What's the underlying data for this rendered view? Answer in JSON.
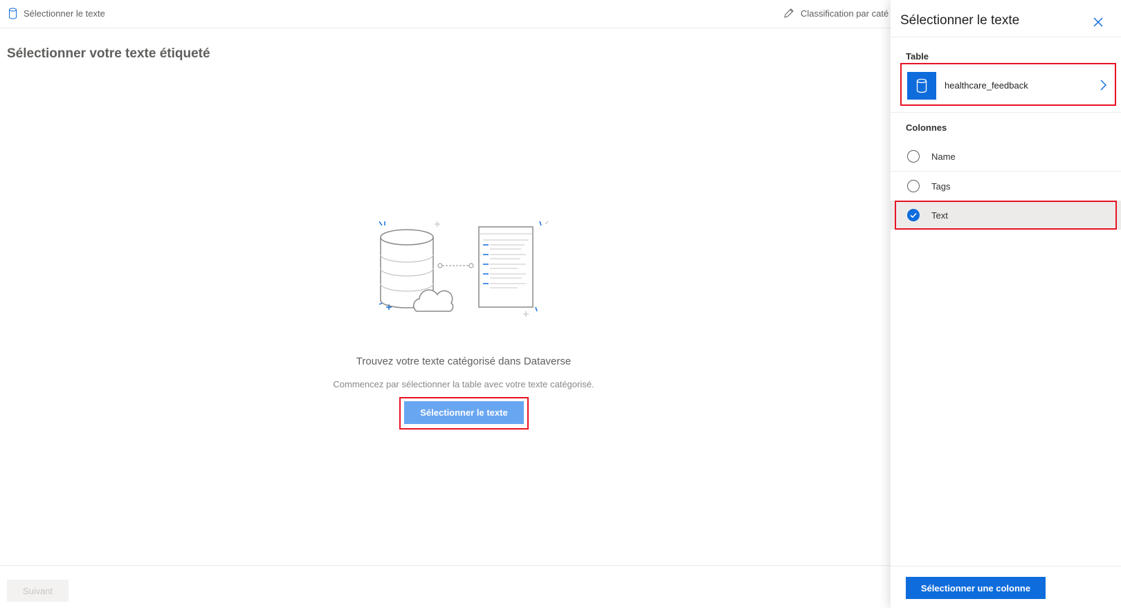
{
  "breadcrumb": {
    "step1_label": "Sélectionner le texte",
    "step2_label": "Classification par caté"
  },
  "page": {
    "title": "Sélectionner votre texte étiqueté",
    "empty_title": "Trouvez votre texte catégorisé dans Dataverse",
    "empty_subtitle": "Commencez par sélectionner la table avec votre texte catégorisé.",
    "select_button": "Sélectionner le texte",
    "next_button": "Suivant"
  },
  "panel": {
    "title": "Sélectionner le texte",
    "table_section_label": "Table",
    "table_name": "healthcare_feedback",
    "columns_section_label": "Colonnes",
    "columns": [
      {
        "label": "Name",
        "selected": false
      },
      {
        "label": "Tags",
        "selected": false
      },
      {
        "label": "Text",
        "selected": true
      }
    ],
    "confirm_button": "Sélectionner une colonne"
  },
  "colors": {
    "accent": "#0f6cdc",
    "highlight": "#e81123"
  }
}
